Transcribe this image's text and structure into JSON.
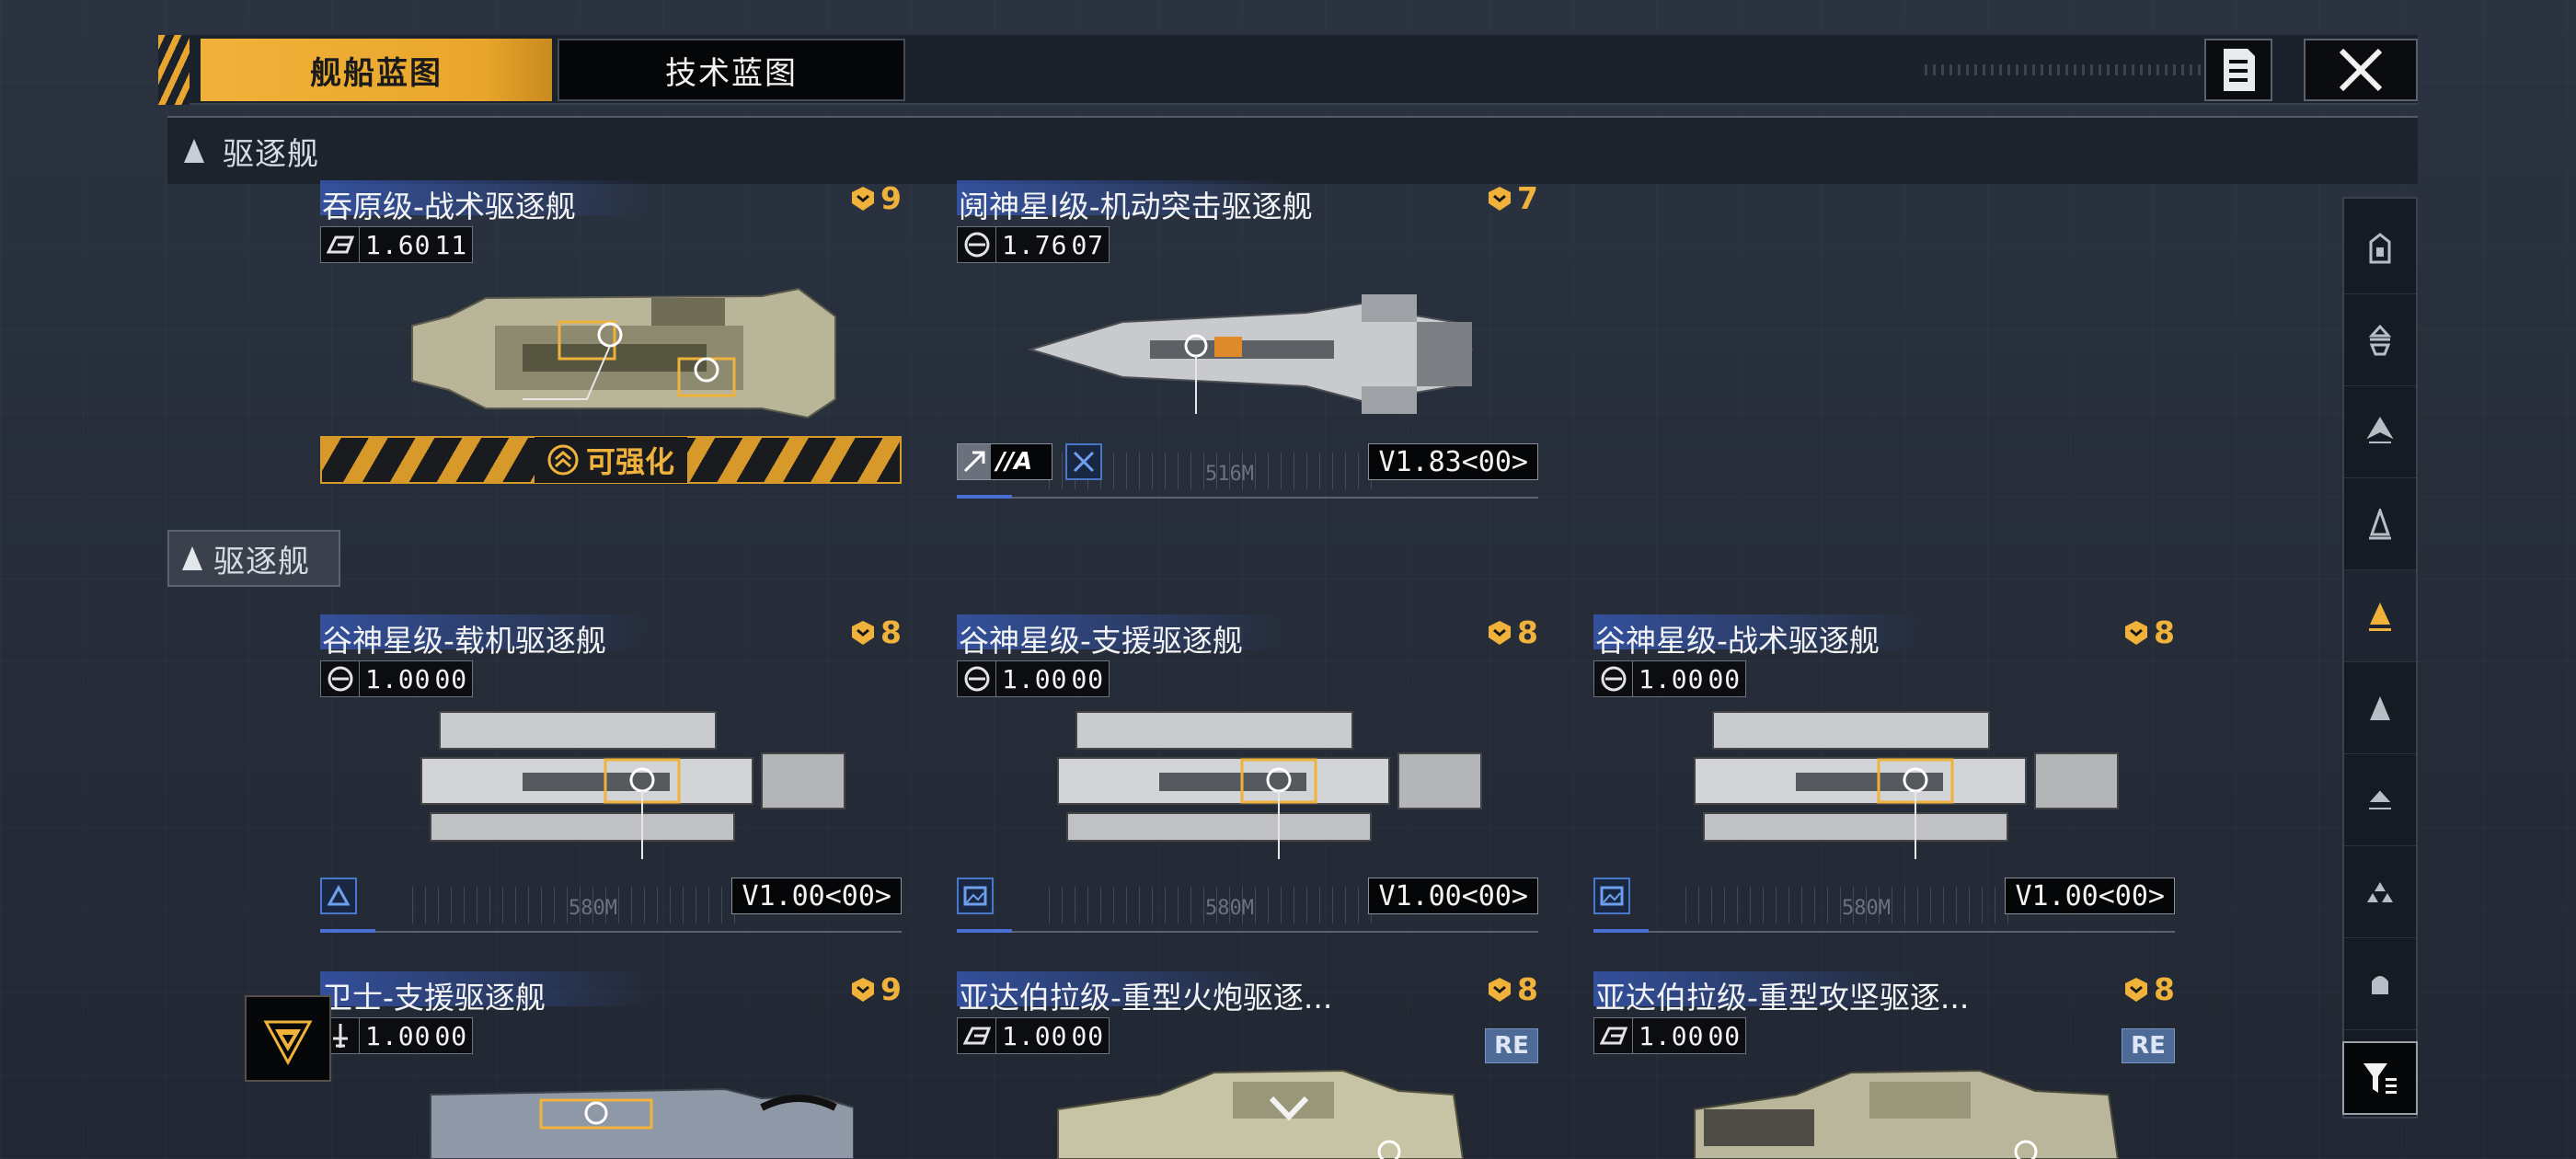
{
  "tabs": [
    {
      "label": "舰船蓝图",
      "active": true
    },
    {
      "label": "技术蓝图",
      "active": false
    }
  ],
  "toolbar": {
    "doc_icon": "document-icon",
    "close_icon": "close-icon"
  },
  "category_header": {
    "label": "驱逐舰",
    "icon": "destroyer-class-icon"
  },
  "section_tag": {
    "label": "驱逐舰",
    "icon": "destroyer-class-icon"
  },
  "colors": {
    "accent": "#F0B23B",
    "blue": "#3A64C8",
    "panel": "#1D232D"
  },
  "cards": [
    {
      "title": "吞原级-战术驱逐舰",
      "rank": "9",
      "version": "1.60",
      "version_suffix": "11",
      "upgrade_label": "可强化",
      "upgradable": true
    },
    {
      "title": "阋神星I级-机动突击驱逐舰",
      "rank": "7",
      "version": "1.76",
      "version_suffix": "07",
      "attack_tag": "//A",
      "dim_label": "516M",
      "vtag": "V1.83<00>"
    },
    {
      "title": "谷神星级-载机驱逐舰",
      "rank": "8",
      "version": "1.00",
      "version_suffix": "00",
      "dim_label": "580M",
      "vtag": "V1.00<00>"
    },
    {
      "title": "谷神星级-支援驱逐舰",
      "rank": "8",
      "version": "1.00",
      "version_suffix": "00",
      "dim_label": "580M",
      "vtag": "V1.00<00>"
    },
    {
      "title": "谷神星级-战术驱逐舰",
      "rank": "8",
      "version": "1.00",
      "version_suffix": "00",
      "dim_label": "580M",
      "vtag": "V1.00<00>"
    },
    {
      "title": "卫士-支援驱逐舰",
      "rank": "9",
      "version": "1.00",
      "version_suffix": "00"
    },
    {
      "title": "亚达伯拉级-重型火炮驱逐...",
      "rank": "8",
      "version": "1.00",
      "version_suffix": "00",
      "badge": "RE"
    },
    {
      "title": "亚达伯拉级-重型攻坚驱逐...",
      "rank": "8",
      "version": "1.00",
      "version_suffix": "00",
      "badge": "RE"
    }
  ],
  "rail": [
    {
      "icon": "carrier-class-icon",
      "selected": false
    },
    {
      "icon": "battleship-class-icon",
      "selected": false
    },
    {
      "icon": "cruiser-class-icon",
      "selected": false
    },
    {
      "icon": "frigate-class-icon",
      "selected": false
    },
    {
      "icon": "destroyer-class-icon",
      "selected": true
    },
    {
      "icon": "corvette-class-icon",
      "selected": false
    },
    {
      "icon": "fighter-class-icon",
      "selected": false
    },
    {
      "icon": "squadron-class-icon",
      "selected": false
    },
    {
      "icon": "support-class-icon",
      "selected": false
    }
  ],
  "filter_icon": "filter-icon",
  "emblem_icon": "faction-emblem-icon"
}
